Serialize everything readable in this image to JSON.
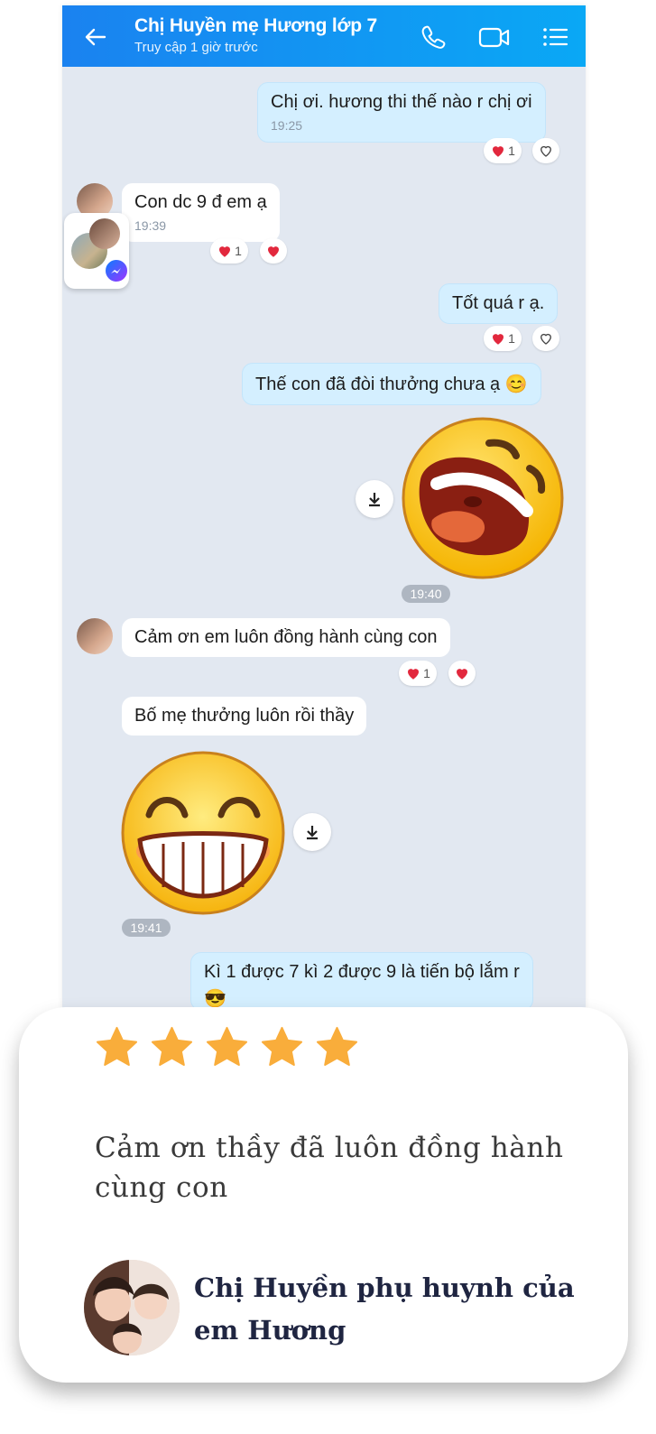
{
  "chat": {
    "contact_name": "Chị Huyền mẹ Hương lớp 7",
    "status": "Truy cập 1 giờ trước",
    "icons": [
      "back-arrow-icon",
      "phone-icon",
      "video-call-icon",
      "menu-list-icon"
    ]
  },
  "messages": [
    {
      "from": "me",
      "text": "Chị ơi. hương thi thế nào r chị ơi",
      "time": "19:25",
      "reaction_count": "1"
    },
    {
      "from": "other",
      "text": "Con dc 9 đ em ạ",
      "time": "19:39",
      "reaction_count": "1"
    },
    {
      "from": "me",
      "text": "Tốt quá r ạ.",
      "reaction_count": "1"
    },
    {
      "from": "me",
      "text": "Thế con đã đòi thưởng chưa ạ 😊"
    },
    {
      "from": "me",
      "sticker": "laughing-face",
      "time": "19:40"
    },
    {
      "from": "other",
      "text": "Cảm ơn em luôn đồng hành cùng con",
      "reaction_count": "1"
    },
    {
      "from": "other",
      "text": "Bố mẹ thưởng luôn rồi thầy"
    },
    {
      "from": "other",
      "sticker": "grinning-face",
      "time": "19:41"
    },
    {
      "from": "me",
      "text": "Kì 1 được 7 kì 2 được 9 là tiến bộ lắm r",
      "emoji": "😎"
    }
  ],
  "review": {
    "rating": 5,
    "quote": "Cảm ơn thầy đã luôn đồng hành cùng con",
    "reviewer": "Chị Huyền phụ huynh của em Hương"
  },
  "colors": {
    "header_start": "#1a82f0",
    "header_end": "#0aa8f5",
    "chat_bg": "#e2e8f1",
    "my_bubble": "#d4efff",
    "star": "#f9ad3b",
    "name_color": "#1f2541"
  }
}
